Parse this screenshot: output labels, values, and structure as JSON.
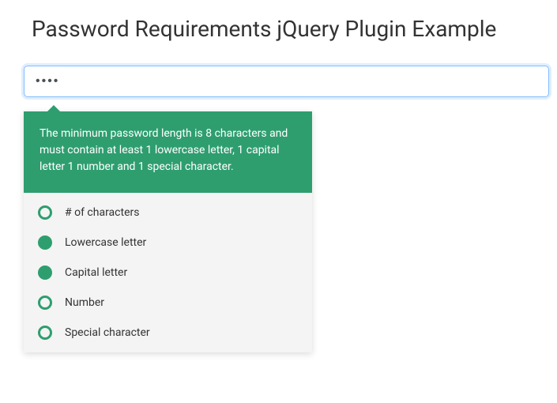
{
  "page": {
    "title": "Password Requirements jQuery Plugin Example"
  },
  "password_field": {
    "value": "••••"
  },
  "tooltip": {
    "message": "The minimum password length is 8 characters and must contain at least 1 lowercase letter, 1 capital letter 1 number and 1 special character."
  },
  "requirements": [
    {
      "label": "# of characters",
      "met": false
    },
    {
      "label": "Lowercase letter",
      "met": true
    },
    {
      "label": "Capital letter",
      "met": true
    },
    {
      "label": "Number",
      "met": false
    },
    {
      "label": "Special character",
      "met": false
    }
  ],
  "colors": {
    "accent": "#2e9e6f",
    "focus_border": "#80bdff"
  }
}
